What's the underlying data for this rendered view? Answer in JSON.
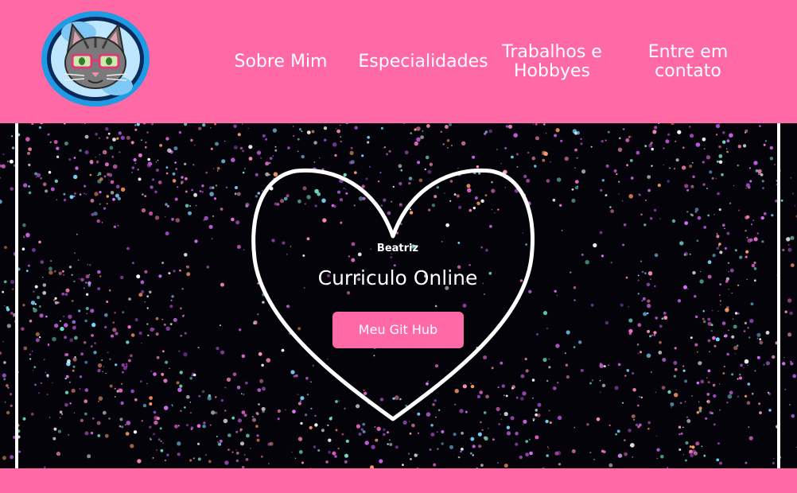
{
  "colors": {
    "brand_pink": "#ff69a6",
    "hero_background": "#05030a",
    "text": "#ffffff"
  },
  "header": {
    "logo_icon": "cat-with-glasses-icon",
    "nav": [
      {
        "label": "Sobre Mim"
      },
      {
        "label": "Especialidades"
      },
      {
        "label": "Trabalhos e Hobbyes"
      },
      {
        "label": "Entre em contato"
      }
    ]
  },
  "hero": {
    "subtitle": "Beatriz",
    "title": "Curriculo Online",
    "button_label": "Meu Git Hub",
    "decor_icon": "heart-outline-icon"
  }
}
